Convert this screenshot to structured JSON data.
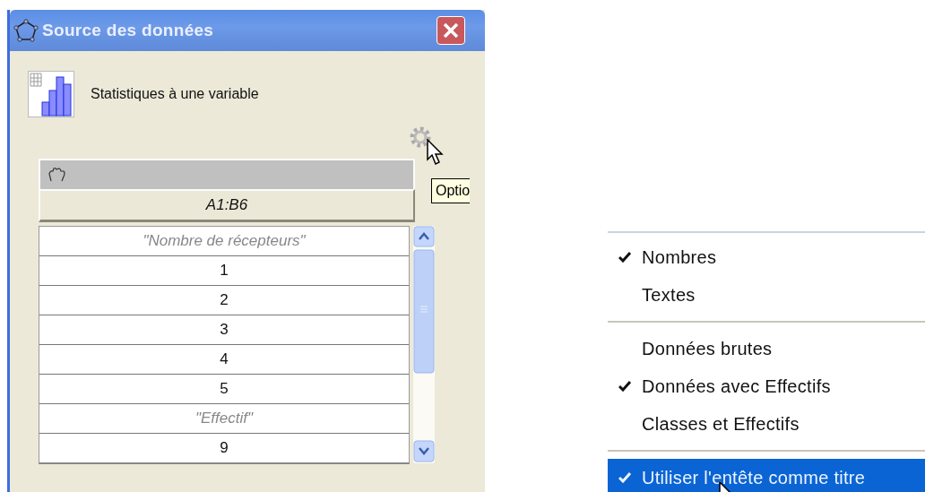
{
  "window": {
    "title": "Source des données"
  },
  "analysis": {
    "label": "Statistiques à une variable"
  },
  "tooltip": {
    "text": "Optio"
  },
  "table": {
    "range": "A1:B6",
    "rows": [
      {
        "text": "\"Nombre de récepteurs\"",
        "kind": "header"
      },
      {
        "text": "1",
        "kind": "value"
      },
      {
        "text": "2",
        "kind": "value"
      },
      {
        "text": "3",
        "kind": "value"
      },
      {
        "text": "4",
        "kind": "value"
      },
      {
        "text": "5",
        "kind": "value"
      },
      {
        "text": "\"Effectif\"",
        "kind": "header"
      },
      {
        "text": "9",
        "kind": "value"
      }
    ]
  },
  "menu": {
    "sections": [
      [
        {
          "label": "Nombres",
          "checked": true,
          "selected": false
        },
        {
          "label": "Textes",
          "checked": false,
          "selected": false
        }
      ],
      [
        {
          "label": "Données brutes",
          "checked": false,
          "selected": false
        },
        {
          "label": "Données avec Effectifs",
          "checked": true,
          "selected": false
        },
        {
          "label": "Classes et Effectifs",
          "checked": false,
          "selected": false
        }
      ],
      [
        {
          "label": "Utiliser l'entête comme titre",
          "checked": true,
          "selected": true
        }
      ]
    ]
  }
}
